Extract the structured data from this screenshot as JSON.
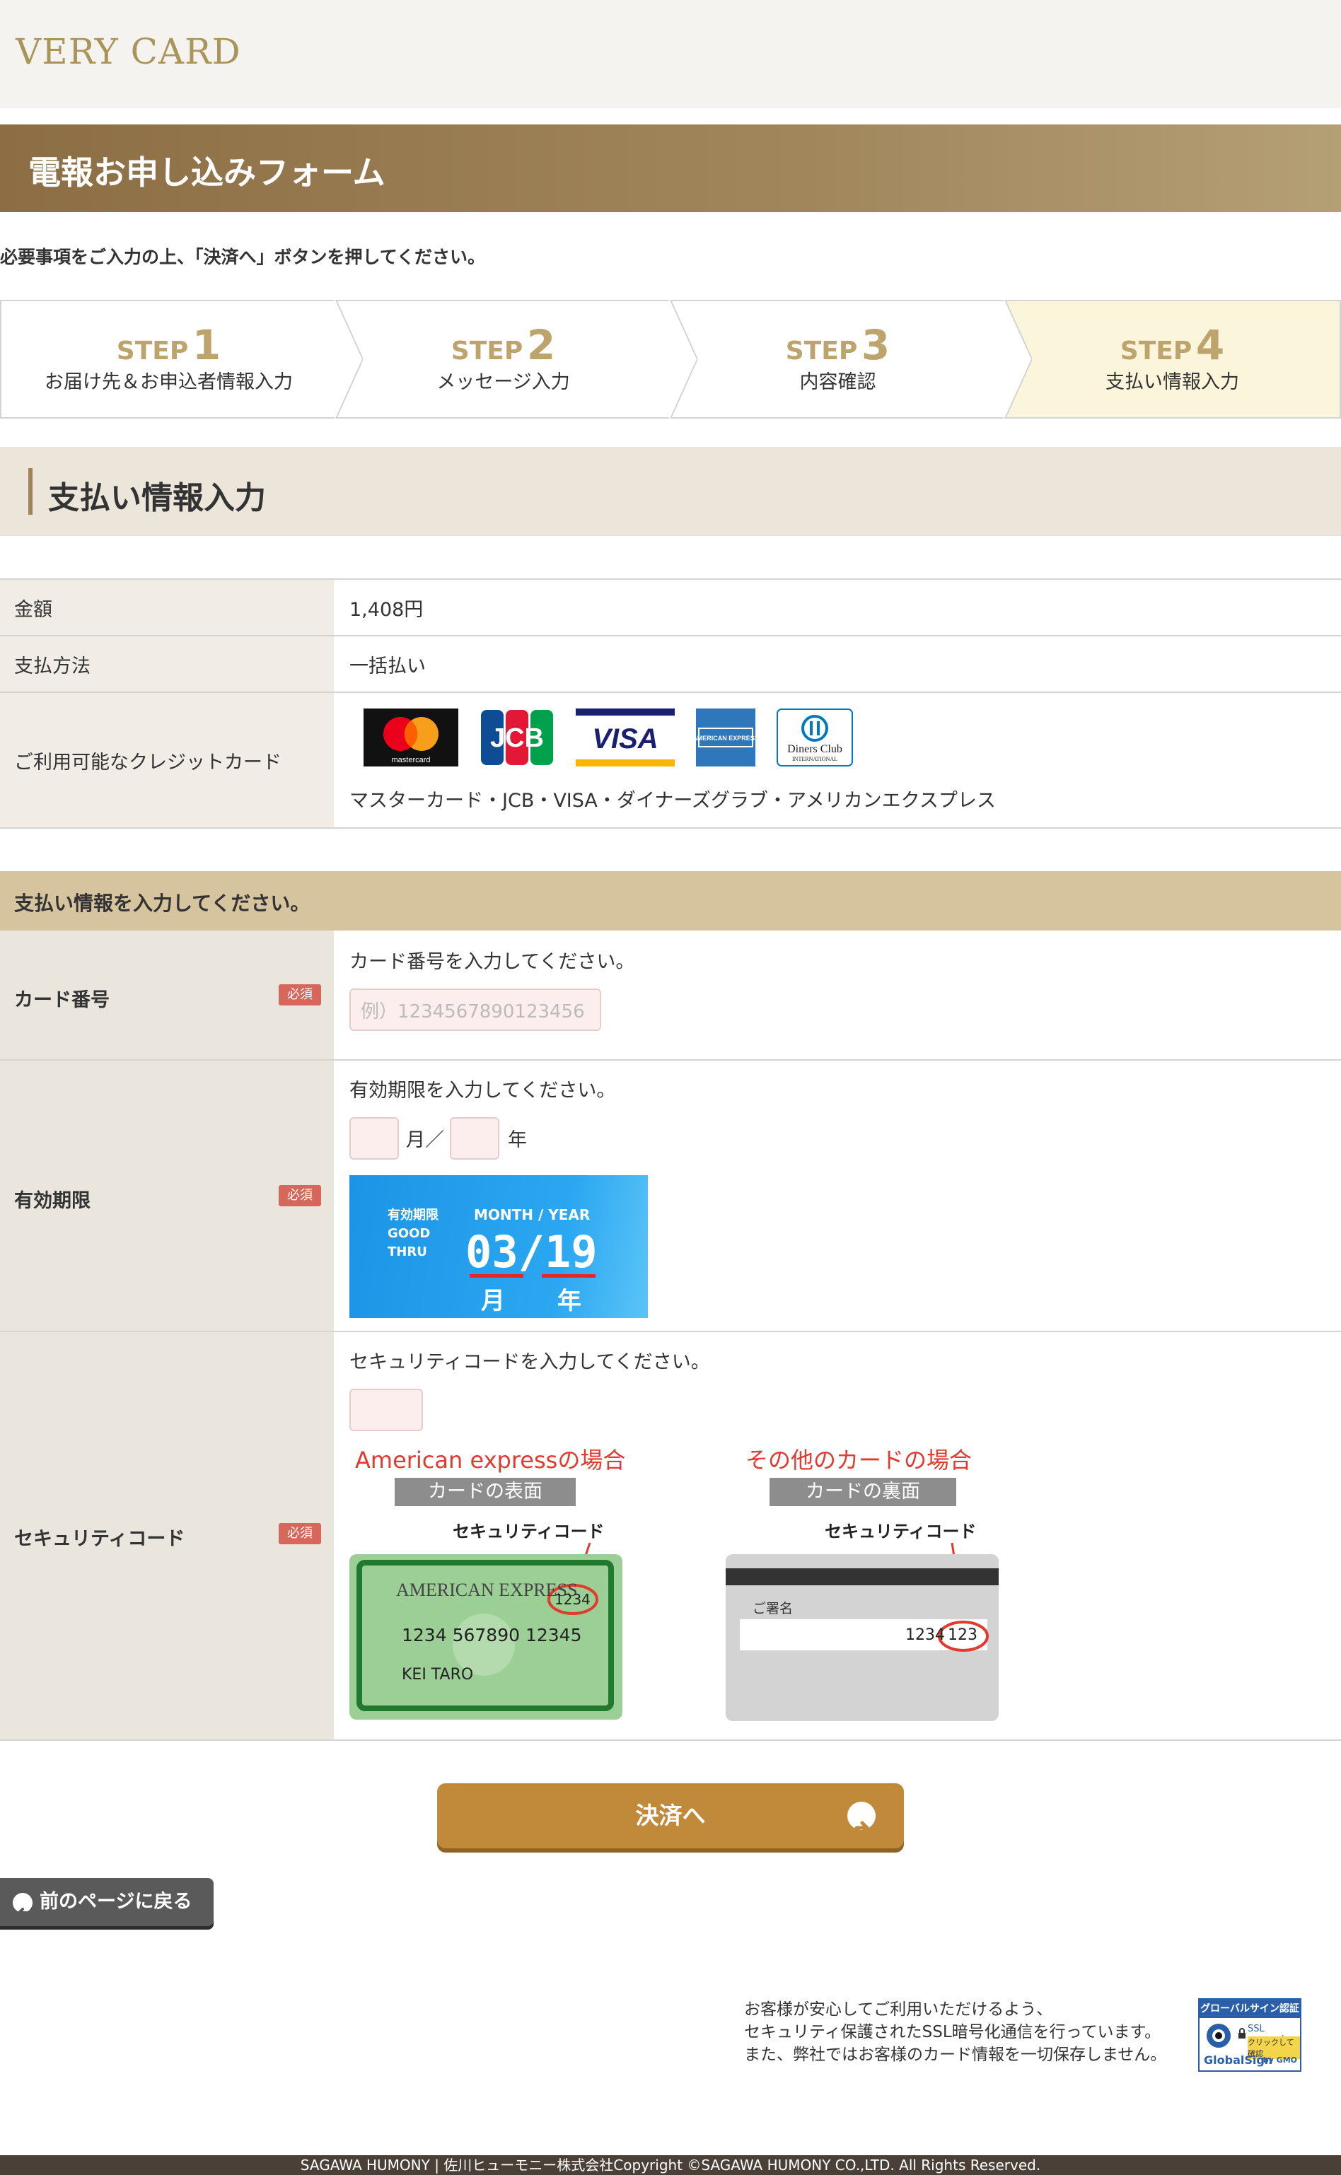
{
  "header": {
    "logo": "VERY CARD"
  },
  "banner": {
    "title": "電報お申し込みフォーム"
  },
  "intro": "必要事項をご入力の上、「決済へ」ボタンを押してください。",
  "steps": [
    {
      "word": "STEP",
      "num": "1",
      "label": "お届け先＆お申込者情報入力"
    },
    {
      "word": "STEP",
      "num": "2",
      "label": "メッセージ入力"
    },
    {
      "word": "STEP",
      "num": "3",
      "label": "内容確認"
    },
    {
      "word": "STEP",
      "num": "4",
      "label": "支払い情報入力"
    }
  ],
  "section_title": "支払い情報入力",
  "info": {
    "amount_label": "金額",
    "amount_value": "1,408円",
    "method_label": "支払方法",
    "method_value": "一括払い",
    "cards_label": "ご利用可能なクレジットカード",
    "cards_text": "マスターカード・JCB・VISA・ダイナーズグラブ・アメリカンエクスプレス",
    "logos": {
      "mastercard": "mastercard",
      "jcb": "JCB",
      "visa": "VISA",
      "amex": "AMERICAN EXPRESS",
      "diners_a": "Diners Club",
      "diners_b": "INTERNATIONAL"
    }
  },
  "form": {
    "heading": "支払い情報を入力してください。",
    "required": "必須",
    "card_number": {
      "label": "カード番号",
      "hint": "カード番号を入力してください。",
      "placeholder": "例）1234567890123456"
    },
    "expiry": {
      "label": "有効期限",
      "hint": "有効期限を入力してください。",
      "month_unit": "月／",
      "year_unit": "年",
      "img_left_1": "有効期限",
      "img_left_2": "GOOD",
      "img_left_3": "THRU",
      "img_header": "MONTH  /  YEAR",
      "img_value": "03/19",
      "img_month": "月",
      "img_year": "年"
    },
    "security": {
      "label": "セキュリティコード",
      "hint": "セキュリティコードを入力してください。",
      "amex_title": "American expressの場合",
      "amex_tag": "カードの表面",
      "other_title": "その他のカードの場合",
      "other_tag": "カードの裏面",
      "code_caption": "セキュリティコード",
      "amex_brand": "AMERICAN EXPRESS",
      "amex_code": "1234",
      "amex_number": "1234 567890 12345",
      "amex_name": "KEI TARO",
      "back_sign": "ご署名",
      "back_num": "1234",
      "back_code": "123"
    }
  },
  "buttons": {
    "pay": "決済へ",
    "back": "前のページに戻る"
  },
  "ssl": {
    "line1": "お客様が安心してご利用いただけるよう、",
    "line2": "セキュリティ保護されたSSL暗号化通信を行っています。",
    "line3": "また、弊社ではお客様のカード情報を一切保存しません。",
    "badge_top": "グローバルサイン認証サイト",
    "badge_mid1": "SSL secured",
    "badge_mid2": "クリックして確認",
    "badge_bottom": "GlobalSign",
    "badge_by": "by GMO"
  },
  "footer": "SAGAWA HUMONY | 佐川ヒューモニー株式会社Copyright ©SAGAWA HUMONY CO.,LTD. All Rights Reserved.",
  "colors": {
    "brand_gold": "#a9955a",
    "banner_brown": "#8d6e44",
    "required_red": "#d7675b",
    "pay_button": "#c18a3b",
    "active_step": "#fbf5dc"
  }
}
